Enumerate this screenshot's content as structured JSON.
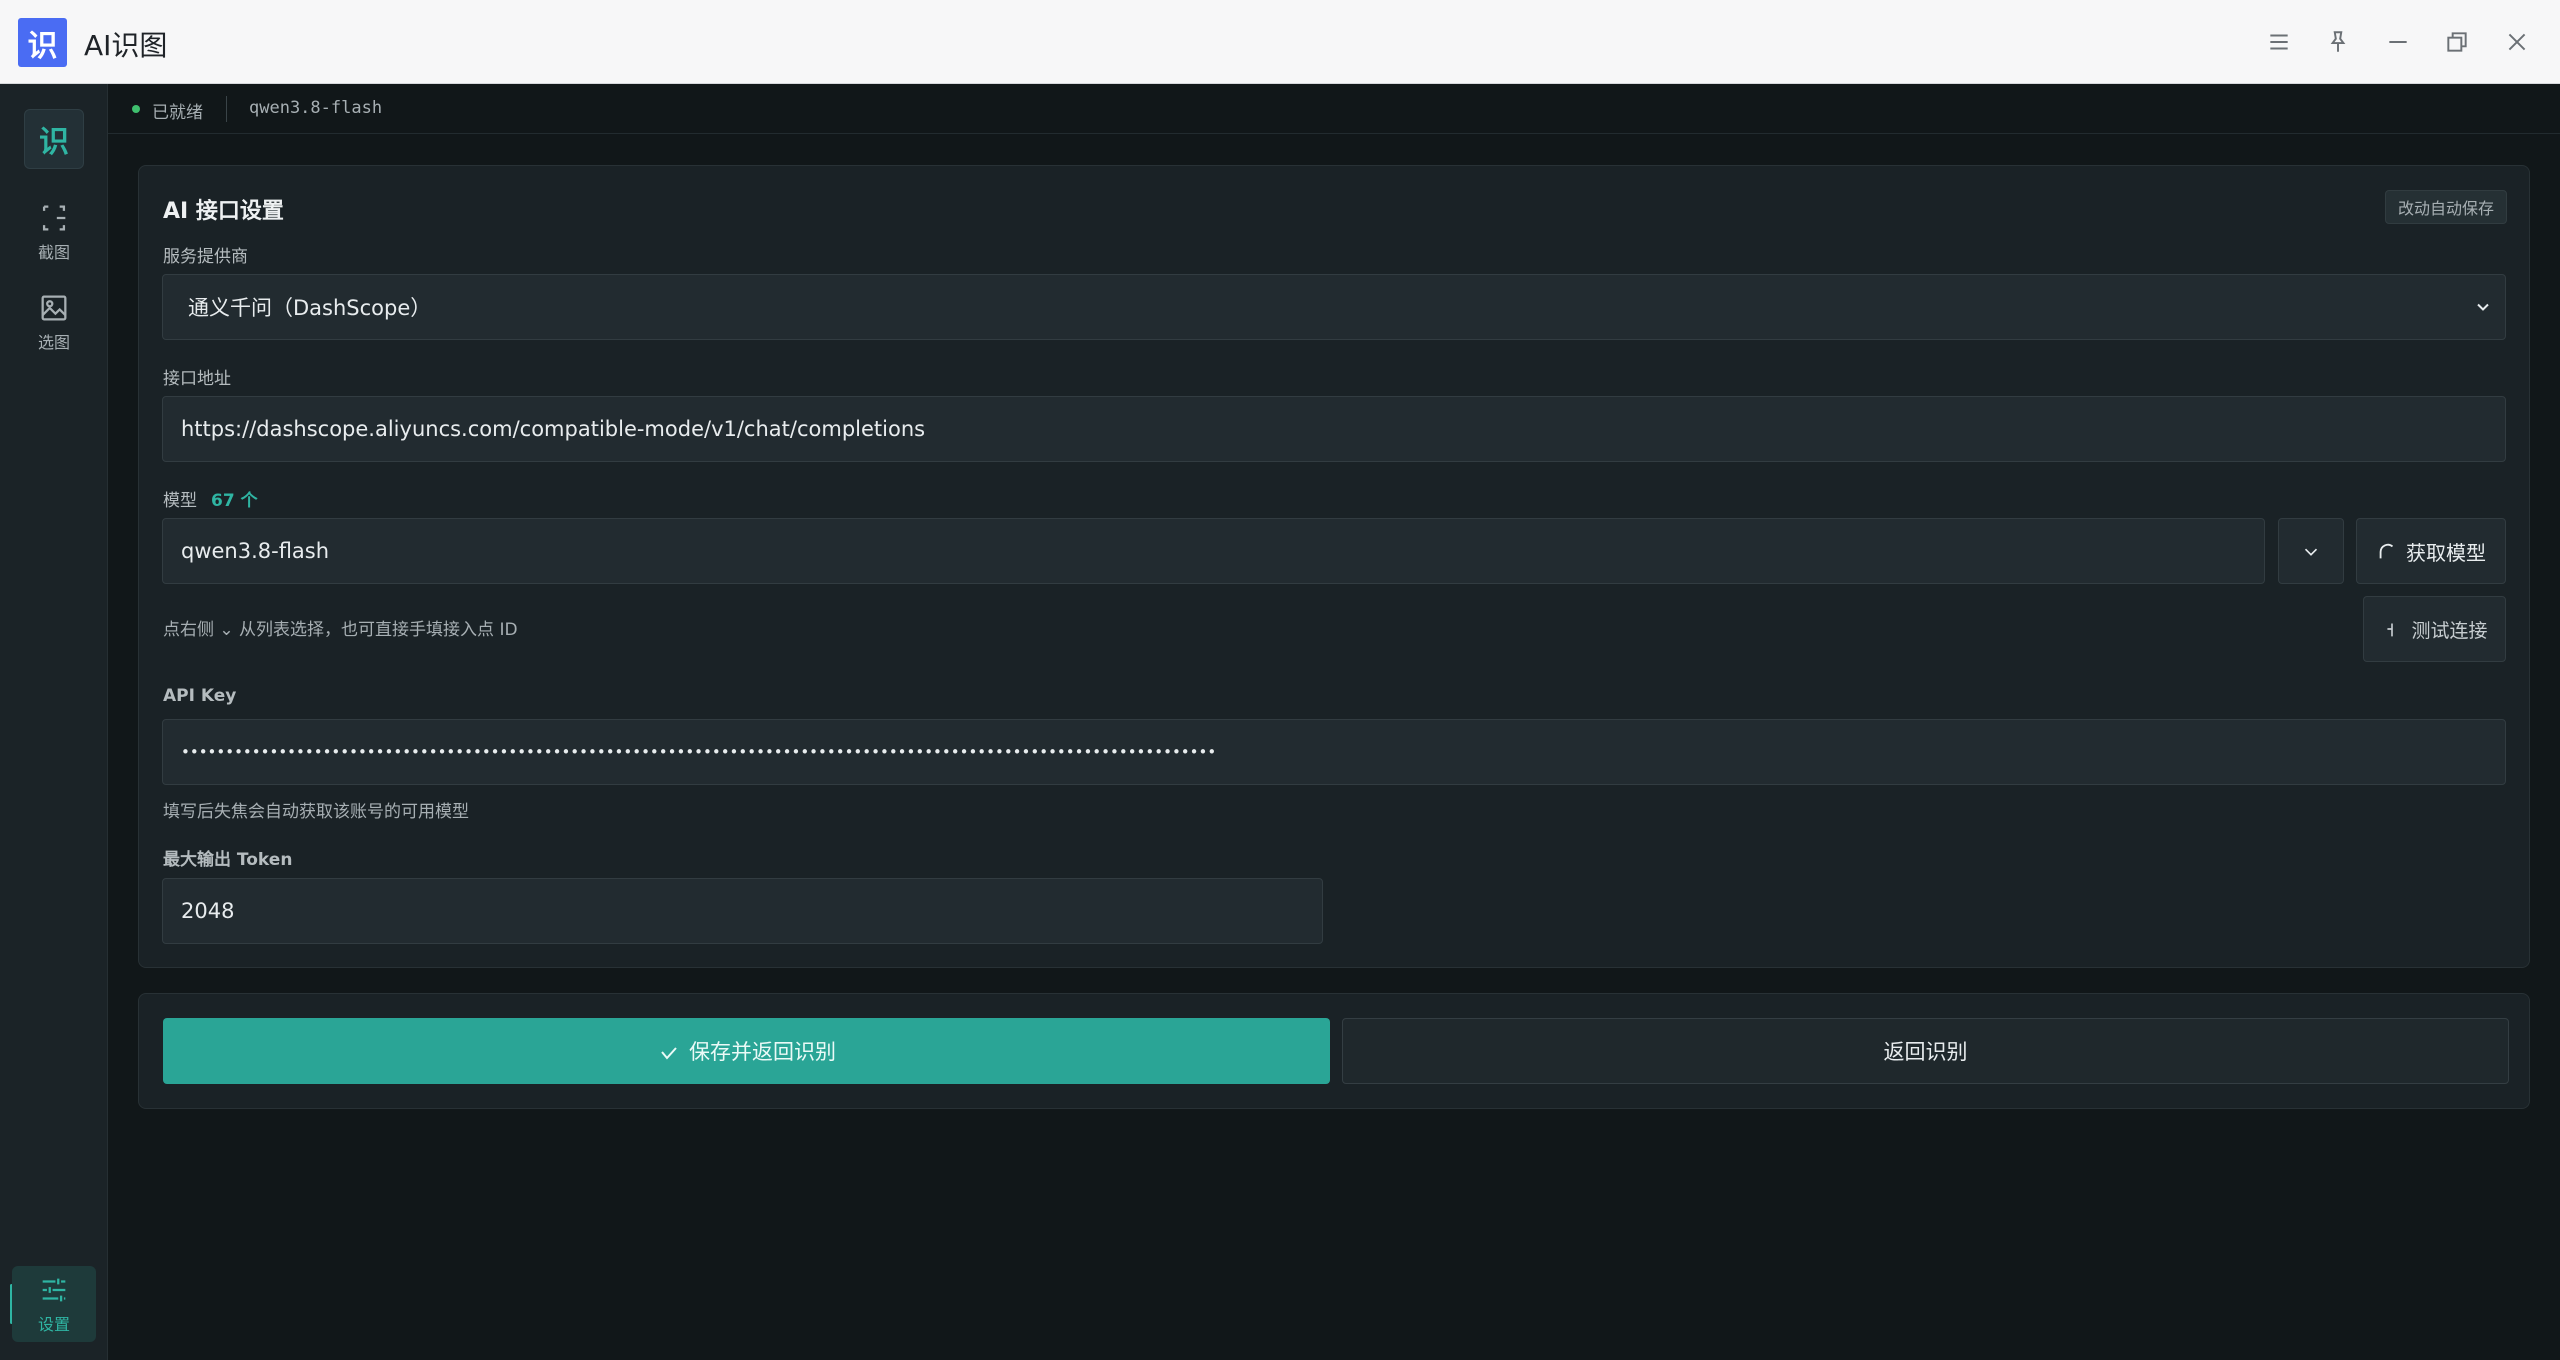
{
  "window": {
    "logo_char": "识",
    "title": "AI识图"
  },
  "sidebar": {
    "logo_char": "识",
    "items": [
      {
        "label": "截图",
        "icon": "screenshot-icon"
      },
      {
        "label": "选图",
        "icon": "image-icon"
      },
      {
        "label": "设置",
        "icon": "sliders-icon",
        "active": true
      }
    ]
  },
  "status": {
    "text": "已就绪",
    "model": "qwen3.8-flash"
  },
  "settings": {
    "title": "AI 接口设置",
    "autosave": "改动自动保存",
    "provider": {
      "label": "服务提供商",
      "value": "通义千问（DashScope）"
    },
    "endpoint": {
      "label": "接口地址",
      "value": "https://dashscope.aliyuncs.com/compatible-mode/v1/chat/completions"
    },
    "model": {
      "label": "模型",
      "count": "67 个",
      "value": "qwen3.8-flash",
      "fetch_label": "获取模型",
      "test_label": "测试连接",
      "hint": "点右侧 ⌄ 从列表选择，也可直接手填接入点 ID"
    },
    "api_key": {
      "label": "API Key",
      "value": "•••••••••••••••••••••••••••••••••••••••••••••••••••••••••••••••••••••••••••••••••••••••••••••••••••••••••••••••••••••",
      "hint": "填写后失焦会自动获取该账号的可用模型"
    },
    "max_tokens": {
      "label": "最大输出 Token",
      "value": "2048"
    }
  },
  "actions": {
    "save_label": "保存并返回识别",
    "back_label": "返回识别"
  },
  "colors": {
    "accent": "#2aa596",
    "logo": "#4a6cf3",
    "status_ok": "#3fbf6e"
  }
}
